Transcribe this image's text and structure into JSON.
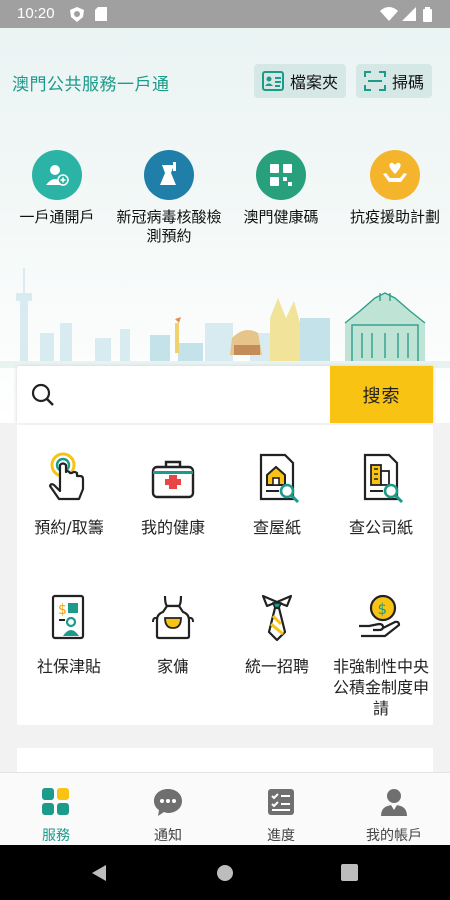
{
  "status_bar": {
    "time": "10:20"
  },
  "header": {
    "app_title": "澳門公共服務一戶通",
    "folder_label": "檔案夾",
    "scan_label": "掃碼"
  },
  "quick_actions": [
    {
      "label": "一戶通開戶",
      "icon": "add-user-icon",
      "color": "#2bb3a6"
    },
    {
      "label": "新冠病毒核酸檢測預約",
      "icon": "test-tube-icon",
      "color": "#1f7fa8"
    },
    {
      "label": "澳門健康碼",
      "icon": "qr-code-icon",
      "color": "#27a07b"
    },
    {
      "label": "抗疫援助計劃",
      "icon": "heart-hands-icon",
      "color": "#f4b52c"
    }
  ],
  "search": {
    "placeholder": "",
    "button_label": "搜索"
  },
  "services": [
    {
      "label": "預約/取籌",
      "icon": "tap-hand-icon"
    },
    {
      "label": "我的健康",
      "icon": "medical-kit-icon"
    },
    {
      "label": "查屋紙",
      "icon": "house-document-search-icon"
    },
    {
      "label": "查公司紙",
      "icon": "company-document-search-icon"
    },
    {
      "label": "社保津貼",
      "icon": "social-security-icon"
    },
    {
      "label": "家傭",
      "icon": "apron-icon"
    },
    {
      "label": "統一招聘",
      "icon": "tie-icon"
    },
    {
      "label": "非強制性中央公積金制度申請",
      "icon": "money-hand-icon"
    }
  ],
  "bottom_nav": [
    {
      "label": "服務",
      "icon": "grid-icon",
      "active": true
    },
    {
      "label": "通知",
      "icon": "chat-bubble-icon",
      "active": false
    },
    {
      "label": "進度",
      "icon": "checklist-icon",
      "active": false
    },
    {
      "label": "我的帳戶",
      "icon": "person-icon",
      "active": false
    }
  ],
  "colors": {
    "accent": "#1c9a8a",
    "search_button": "#f8c313"
  }
}
